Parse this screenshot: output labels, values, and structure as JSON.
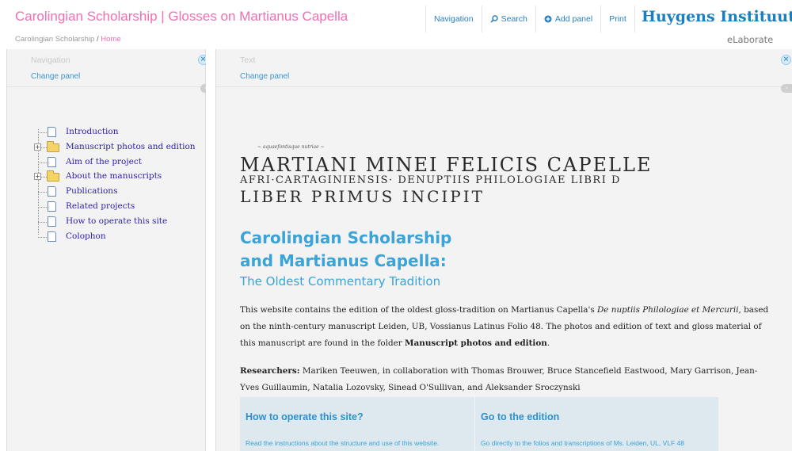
{
  "header": {
    "site_title": "Carolingian Scholarship | Glosses on Martianus Capella",
    "breadcrumb_root": "Carolingian Scholarship",
    "breadcrumb_sep": "/",
    "breadcrumb_current": "Home",
    "nav": {
      "navigation": "Navigation",
      "search": "Search",
      "add_panel": "Add panel",
      "print": "Print"
    },
    "logo_main": "Huygens Instituut",
    "logo_sub": "eLaborate"
  },
  "left_panel": {
    "label": "Navigation",
    "change": "Change panel",
    "close_glyph": "×",
    "collapse_glyph": "‹ ›",
    "tree": [
      {
        "label": "Introduction",
        "icon": "page-icon",
        "expandable": false
      },
      {
        "label": "Manuscript photos and edition",
        "icon": "folder-icon",
        "expandable": true
      },
      {
        "label": "Aim of the project",
        "icon": "page-icon",
        "expandable": false
      },
      {
        "label": "About the manuscripts",
        "icon": "folder-icon",
        "expandable": true
      },
      {
        "label": "Publications",
        "icon": "page-icon",
        "expandable": false
      },
      {
        "label": "Related projects",
        "icon": "page-icon",
        "expandable": false
      },
      {
        "label": "How to operate this site",
        "icon": "page-icon",
        "expandable": false
      },
      {
        "label": "Colophon",
        "icon": "page-icon",
        "expandable": false
      }
    ]
  },
  "right_panel": {
    "label": "Text",
    "change": "Change panel",
    "close_glyph": "×",
    "collapse_glyph": "‹"
  },
  "content": {
    "manuscript_small": "~ aquaefontisque nutriae ~",
    "manuscript_line1": "MARTIANI MINEI FELICIS CAPELLE",
    "manuscript_line2": "AFRI·CARTAGINIENSIS· DENUPTIIS PHILOLOGIAE LIBRI D",
    "manuscript_line3": "LIBER PRIMUS INCIPIT",
    "title_line1": "Carolingian Scholarship",
    "title_line2": "and Martianus Capella:",
    "subtitle": "The Oldest Commentary Tradition",
    "para1_a": "This website contains the edition of the oldest gloss-tradition on Martianus Capella's ",
    "para1_b": "De nuptiis Philologiae et Mercurii",
    "para1_c": ", based on the ninth-century manuscript Leiden, UB, Vossianus Latinus Folio 48. The photos and edition of text and gloss material of this manuscript are found in the folder ",
    "para1_d": "Manuscript photos and edition",
    "para1_e": ".",
    "para2_label": "Researchers:",
    "para2_text": " Mariken Teeuwen, in collaboration with Thomas Brouwer, Bruce Stancefield Eastwood, Mary Garrison, Jean-Yves Guillaumin, Natalia Lozovsky, Sinead O'Sullivan, and Aleksander Sroczynski",
    "card_left_title": "How to operate this site?",
    "card_left_desc": "Read the instructions about the structure and use of this website.",
    "card_right_title": "Go to the edition",
    "card_right_desc": "Go directly to the folios and transcriptions of Ms. Leiden, UL, VLF 48"
  },
  "colors": {
    "title_pink": "#f06fb3",
    "link_blue": "#2a7fbf",
    "heading_blue": "#3aa3d7",
    "tree_text": "#2a1fa8",
    "panel_bg": "#f3f3f3"
  }
}
